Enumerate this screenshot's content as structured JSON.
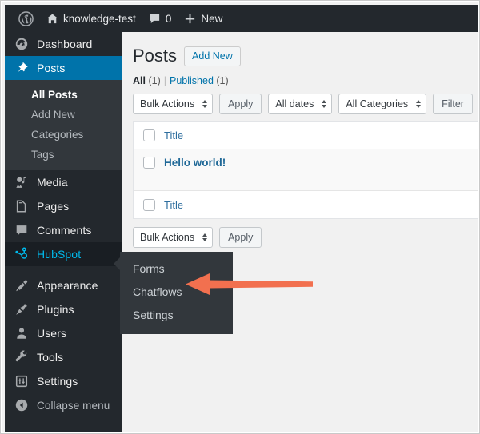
{
  "admin_bar": {
    "wp_logo": "wordpress-logo-icon",
    "site_name": "knowledge-test",
    "home_icon": "home-icon",
    "comments_icon": "comment-bubble-icon",
    "comments_count": "0",
    "new_icon": "plus-icon",
    "new_label": "New"
  },
  "sidebar": {
    "items": [
      {
        "label": "Dashboard",
        "icon": "dashboard-icon",
        "state": "normal"
      },
      {
        "label": "Posts",
        "icon": "pin-icon",
        "state": "active"
      },
      {
        "label": "Media",
        "icon": "media-icon",
        "state": "normal"
      },
      {
        "label": "Pages",
        "icon": "page-icon",
        "state": "normal"
      },
      {
        "label": "Comments",
        "icon": "comment-bubble-icon",
        "state": "normal"
      },
      {
        "label": "HubSpot",
        "icon": "hubspot-sprocket-icon",
        "state": "current-open"
      },
      {
        "label": "Appearance",
        "icon": "paintbrush-icon",
        "state": "normal"
      },
      {
        "label": "Plugins",
        "icon": "plug-icon",
        "state": "normal"
      },
      {
        "label": "Users",
        "icon": "user-icon",
        "state": "normal"
      },
      {
        "label": "Tools",
        "icon": "wrench-icon",
        "state": "normal"
      },
      {
        "label": "Settings",
        "icon": "sliders-icon",
        "state": "normal"
      },
      {
        "label": "Collapse menu",
        "icon": "collapse-left-icon",
        "state": "collapse"
      }
    ],
    "posts_submenu": [
      {
        "label": "All Posts",
        "current": true
      },
      {
        "label": "Add New",
        "current": false
      },
      {
        "label": "Categories",
        "current": false
      },
      {
        "label": "Tags",
        "current": false
      }
    ],
    "hubspot_flyout": [
      {
        "label": "Forms"
      },
      {
        "label": "Chatflows"
      },
      {
        "label": "Settings"
      }
    ]
  },
  "main": {
    "page_title": "Posts",
    "add_new_label": "Add New",
    "filter_links": {
      "all_label": "All",
      "all_count": "(1)",
      "divider": "|",
      "published_label": "Published",
      "published_count": "(1)"
    },
    "tablenav_top": {
      "bulk_actions": "Bulk Actions",
      "apply_label": "Apply",
      "dates_filter": "All dates",
      "categories_filter": "All Categories",
      "filter_label": "Filter"
    },
    "tablenav_bottom": {
      "bulk_actions": "Bulk Actions",
      "apply_label": "Apply"
    },
    "table": {
      "column_header": "Title",
      "column_footer": "Title",
      "rows": [
        {
          "title": "Hello world!"
        }
      ]
    }
  },
  "annotation": {
    "arrow_icon": "left-pointing-arrow-icon",
    "arrow_color": "#f2704f",
    "points_to": "Chatflows"
  },
  "colors": {
    "admin_bar_bg": "#23282d",
    "sidebar_bg": "#23282d",
    "submenu_bg": "#32373c",
    "active_blue": "#0073aa",
    "link_blue": "#0073aa",
    "hubspot_highlight": "#00b9eb",
    "content_bg": "#f1f1f1",
    "arrow": "#f2704f"
  }
}
